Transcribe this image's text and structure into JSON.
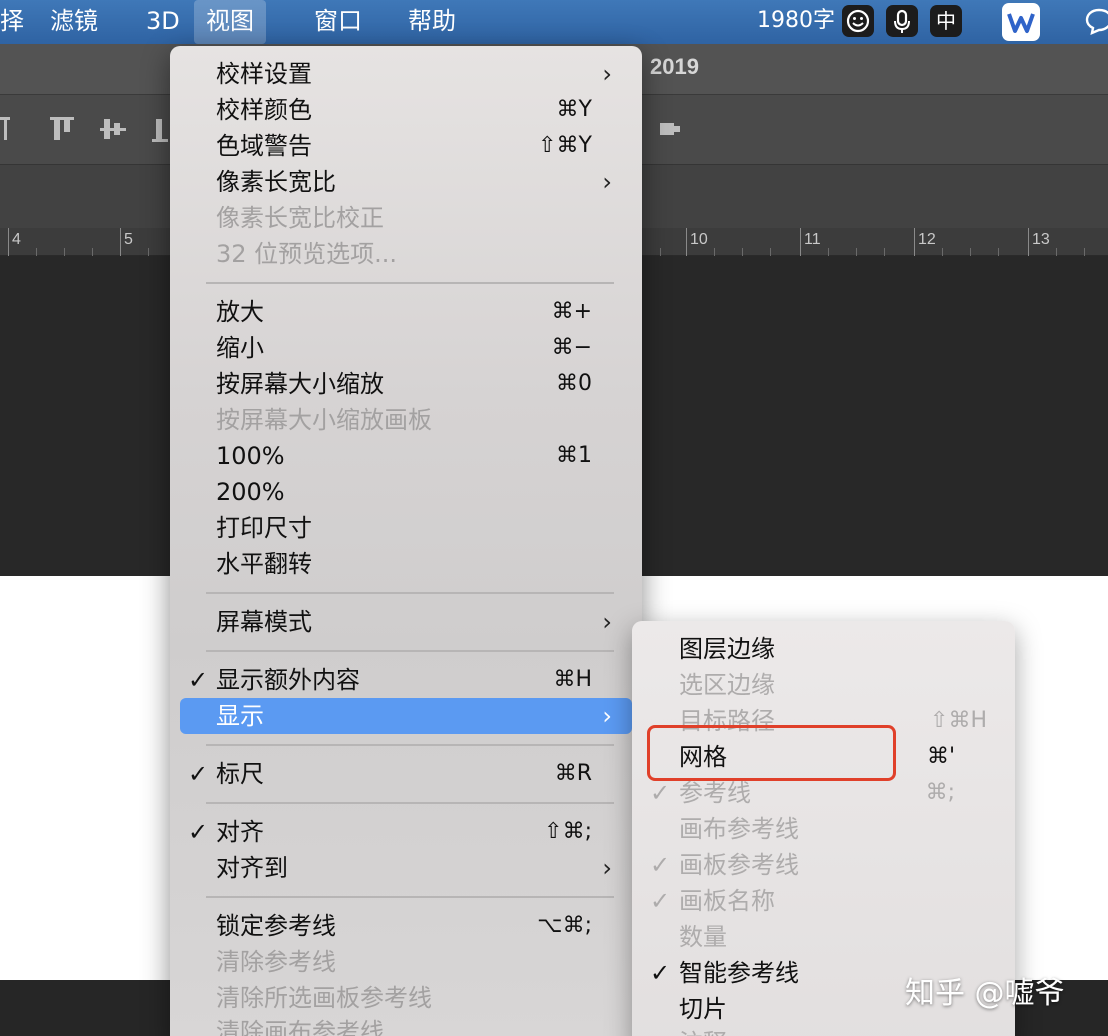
{
  "menubar": {
    "items": [
      "择",
      "滤镜",
      "3D",
      "视图",
      "窗口",
      "帮助"
    ],
    "word_count": "1980字",
    "ime": "中",
    "colors": {
      "bar": "#3a70b0",
      "highlight": "#5b9af2"
    }
  },
  "photoshop": {
    "title_fragment": "2019",
    "ruler_numbers": [
      "4",
      "5",
      "10",
      "11",
      "12",
      "13"
    ]
  },
  "view_menu": {
    "groups": [
      [
        {
          "label": "校样设置",
          "shortcut": "",
          "submenu": true,
          "enabled": true,
          "checked": false
        },
        {
          "label": "校样颜色",
          "shortcut": "⌘Y",
          "submenu": false,
          "enabled": true,
          "checked": false
        },
        {
          "label": "色域警告",
          "shortcut": "⇧⌘Y",
          "submenu": false,
          "enabled": true,
          "checked": false
        },
        {
          "label": "像素长宽比",
          "shortcut": "",
          "submenu": true,
          "enabled": true,
          "checked": false
        },
        {
          "label": "像素长宽比校正",
          "shortcut": "",
          "submenu": false,
          "enabled": false,
          "checked": false
        },
        {
          "label": "32 位预览选项...",
          "shortcut": "",
          "submenu": false,
          "enabled": false,
          "checked": false
        }
      ],
      [
        {
          "label": "放大",
          "shortcut": "⌘+",
          "submenu": false,
          "enabled": true,
          "checked": false
        },
        {
          "label": "缩小",
          "shortcut": "⌘−",
          "submenu": false,
          "enabled": true,
          "checked": false
        },
        {
          "label": "按屏幕大小缩放",
          "shortcut": "⌘0",
          "submenu": false,
          "enabled": true,
          "checked": false
        },
        {
          "label": "按屏幕大小缩放画板",
          "shortcut": "",
          "submenu": false,
          "enabled": false,
          "checked": false
        },
        {
          "label": "100%",
          "shortcut": "⌘1",
          "submenu": false,
          "enabled": true,
          "checked": false
        },
        {
          "label": "200%",
          "shortcut": "",
          "submenu": false,
          "enabled": true,
          "checked": false
        },
        {
          "label": "打印尺寸",
          "shortcut": "",
          "submenu": false,
          "enabled": true,
          "checked": false
        },
        {
          "label": "水平翻转",
          "shortcut": "",
          "submenu": false,
          "enabled": true,
          "checked": false
        }
      ],
      [
        {
          "label": "屏幕模式",
          "shortcut": "",
          "submenu": true,
          "enabled": true,
          "checked": false
        }
      ],
      [
        {
          "label": "显示额外内容",
          "shortcut": "⌘H",
          "submenu": false,
          "enabled": true,
          "checked": true
        },
        {
          "label": "显示",
          "shortcut": "",
          "submenu": true,
          "enabled": true,
          "checked": false,
          "highlighted": true
        }
      ],
      [
        {
          "label": "标尺",
          "shortcut": "⌘R",
          "submenu": false,
          "enabled": true,
          "checked": true
        }
      ],
      [
        {
          "label": "对齐",
          "shortcut": "⇧⌘;",
          "submenu": false,
          "enabled": true,
          "checked": true
        },
        {
          "label": "对齐到",
          "shortcut": "",
          "submenu": true,
          "enabled": true,
          "checked": false
        }
      ],
      [
        {
          "label": "锁定参考线",
          "shortcut": "⌥⌘;",
          "submenu": false,
          "enabled": true,
          "checked": false
        },
        {
          "label": "清除参考线",
          "shortcut": "",
          "submenu": false,
          "enabled": false,
          "checked": false
        },
        {
          "label": "清除所选画板参考线",
          "shortcut": "",
          "submenu": false,
          "enabled": false,
          "checked": false
        },
        {
          "label": "清除画布参考线",
          "shortcut": "",
          "submenu": false,
          "enabled": false,
          "checked": false
        }
      ]
    ]
  },
  "show_submenu": {
    "items": [
      {
        "label": "图层边缘",
        "shortcut": "",
        "enabled": true,
        "checked": false
      },
      {
        "label": "选区边缘",
        "shortcut": "",
        "enabled": false,
        "checked": false
      },
      {
        "label": "目标路径",
        "shortcut": "⇧⌘H",
        "enabled": false,
        "checked": false
      },
      {
        "label": "网格",
        "shortcut": "⌘'",
        "enabled": true,
        "checked": false
      },
      {
        "label": "参考线",
        "shortcut": "⌘;",
        "enabled": false,
        "checked": true
      },
      {
        "label": "画布参考线",
        "shortcut": "",
        "enabled": false,
        "checked": false
      },
      {
        "label": "画板参考线",
        "shortcut": "",
        "enabled": false,
        "checked": true
      },
      {
        "label": "画板名称",
        "shortcut": "",
        "enabled": false,
        "checked": true
      },
      {
        "label": "数量",
        "shortcut": "",
        "enabled": false,
        "checked": false
      },
      {
        "label": "智能参考线",
        "shortcut": "",
        "enabled": true,
        "checked": true
      },
      {
        "label": "切片",
        "shortcut": "",
        "enabled": true,
        "checked": false
      },
      {
        "label": "注释",
        "shortcut": "",
        "enabled": false,
        "checked": false
      }
    ]
  },
  "watermark": "知乎 @嘘爷"
}
